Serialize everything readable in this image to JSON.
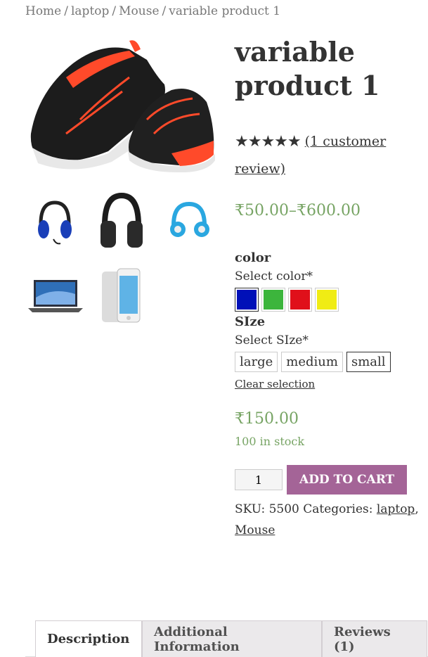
{
  "breadcrumb": {
    "home": "Home",
    "cat1": "laptop",
    "cat2": "Mouse",
    "current": "variable product 1",
    "sep": "/"
  },
  "product": {
    "title": "variable product 1",
    "stars": "★★★★★",
    "review_link": "(1 customer review)",
    "price_range": "₹50.00–₹600.00"
  },
  "color_attr": {
    "title": "color",
    "select_label": "Select color*",
    "swatches": [
      {
        "name": "blue",
        "hex": "#0010b8"
      },
      {
        "name": "green",
        "hex": "#3cb53c"
      },
      {
        "name": "red",
        "hex": "#e0101a"
      },
      {
        "name": "yellow",
        "hex": "#f0ec14"
      }
    ]
  },
  "size_attr": {
    "title": "SIze",
    "select_label": "Select SIze*",
    "options": [
      "large",
      "medium",
      "small"
    ],
    "selected": "small"
  },
  "clear_selection": "Clear selection",
  "variation": {
    "price": "₹150.00",
    "stock": "100 in stock"
  },
  "cart": {
    "qty": "1",
    "add_to_cart": "ADD TO CART"
  },
  "meta": {
    "sku": "SKU: 5500 Categories: ",
    "cat1": "laptop",
    "comma": ",",
    "cat2": "Mouse"
  },
  "tabs": [
    "Description",
    "Additional Information",
    "Reviews (1)"
  ],
  "colors": {
    "accent": "#a46497",
    "price": "#77a464",
    "shoe_black": "#1c1c1c",
    "shoe_red": "#ff4a2a"
  }
}
